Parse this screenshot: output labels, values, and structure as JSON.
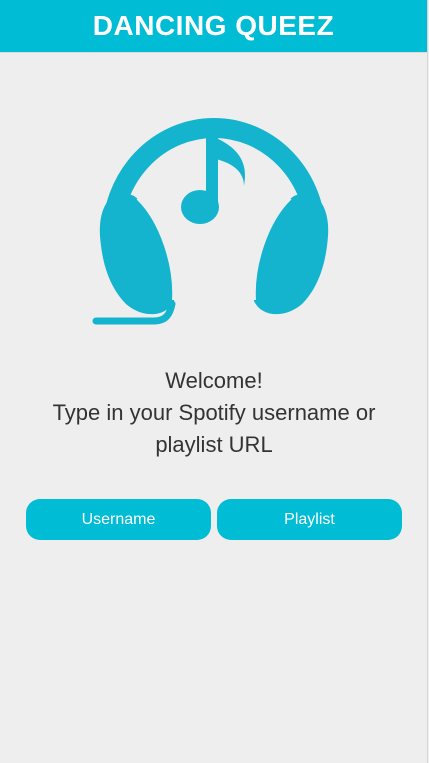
{
  "header": {
    "title": "DANCING QUEEZ"
  },
  "logo": {
    "icon": "headphones-music-note-icon",
    "color": "#14b4cf"
  },
  "welcome": {
    "line1": "Welcome!",
    "line2": "Type in your Spotify username or",
    "line3": "playlist URL"
  },
  "buttons": {
    "username_label": "Username",
    "playlist_label": "Playlist"
  },
  "colors": {
    "accent": "#00bcd4",
    "background": "#eeeeee",
    "text": "#333333"
  }
}
